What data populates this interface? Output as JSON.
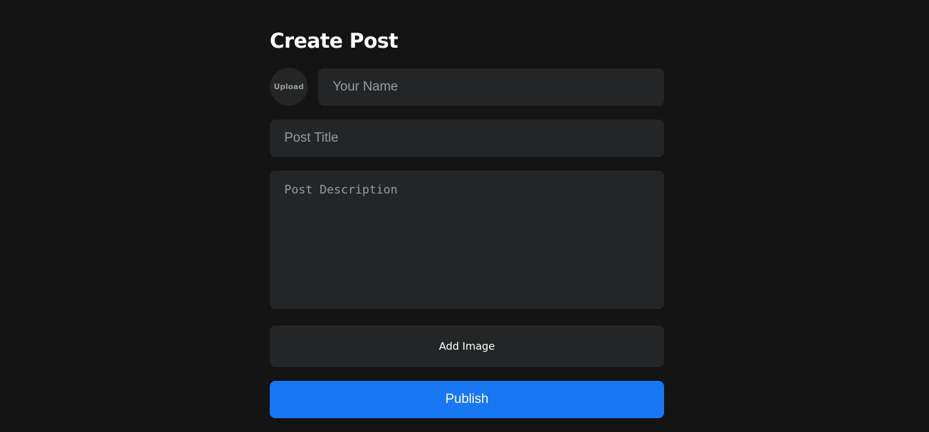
{
  "page": {
    "title": "Create Post"
  },
  "form": {
    "upload_label": "Upload",
    "name_placeholder": "Your Name",
    "name_value": "",
    "title_placeholder": "Post Title",
    "title_value": "",
    "description_placeholder": "Post Description",
    "description_value": "",
    "add_image_label": "Add Image",
    "publish_label": "Publish"
  },
  "colors": {
    "background": "#141414",
    "field_background": "#242526",
    "accent": "#1877f2",
    "placeholder_text": "#9a9b9d"
  }
}
